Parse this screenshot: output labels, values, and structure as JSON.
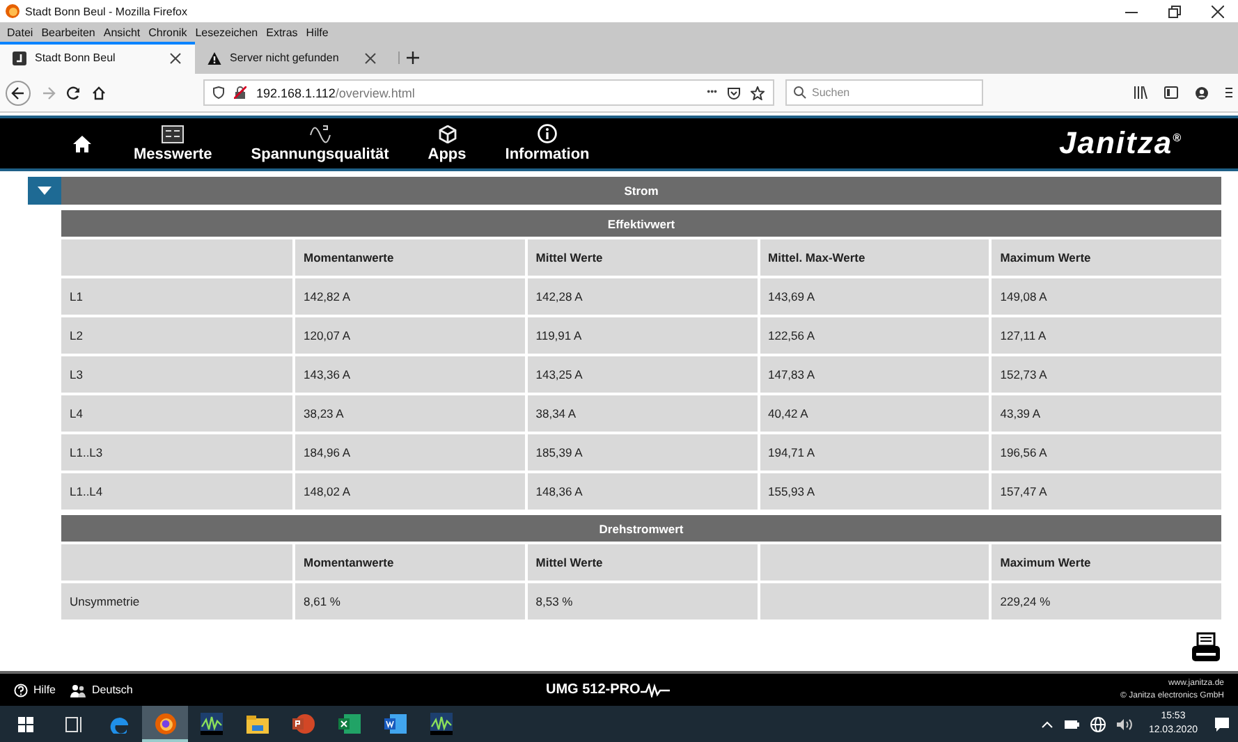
{
  "window": {
    "title": "Stadt Bonn Beul - Mozilla Firefox"
  },
  "menu": [
    "Datei",
    "Bearbeiten",
    "Ansicht",
    "Chronik",
    "Lesezeichen",
    "Extras",
    "Hilfe"
  ],
  "tabs": [
    {
      "label": "Stadt Bonn Beul",
      "kind": "page",
      "selected": true
    },
    {
      "label": "Server nicht gefunden",
      "kind": "warning",
      "selected": false
    }
  ],
  "address_bar": {
    "host": "192.168.1.112",
    "path": "/overview.html",
    "more": "•••"
  },
  "search": {
    "placeholder": "Suchen"
  },
  "app_nav": [
    {
      "label": "Messwerte",
      "kind": "meter"
    },
    {
      "label": "Spannungsqualität",
      "kind": "wave"
    },
    {
      "label": "Apps",
      "kind": "apps"
    },
    {
      "label": "Information",
      "kind": "info"
    }
  ],
  "logo": "Janitza$^{®}$",
  "section": {
    "title": "Strom",
    "expanded": true
  },
  "tables": [
    {
      "title": "Effektivwert",
      "columns": [
        {
          "text": "Momentanwerte"
        },
        {
          "text": "Mittel Werte"
        },
        {
          "text": "Mittel. Max-Werte"
        },
        {
          "text": "Maximum Werte"
        }
      ],
      "rows": [
        {
          "label": "L1",
          "values": [
            {
              "text": "142,82 A"
            },
            {
              "text": "142,28 A"
            },
            {
              "text": "143,69 A"
            },
            {
              "text": "149,08 A"
            }
          ]
        },
        {
          "label": "L2",
          "values": [
            {
              "text": "120,07 A"
            },
            {
              "text": "119,91 A"
            },
            {
              "text": "122,56 A"
            },
            {
              "text": "127,11 A"
            }
          ]
        },
        {
          "label": "L3",
          "values": [
            {
              "text": "143,36 A"
            },
            {
              "text": "143,25 A"
            },
            {
              "text": "147,83 A"
            },
            {
              "text": "152,73 A"
            }
          ]
        },
        {
          "label": "L4",
          "values": [
            {
              "text": "38,23 A"
            },
            {
              "text": "38,34 A"
            },
            {
              "text": "40,42 A"
            },
            {
              "text": "43,39 A"
            }
          ]
        },
        {
          "label": "L1..L3",
          "values": [
            {
              "text": "184,96 A"
            },
            {
              "text": "185,39 A"
            },
            {
              "text": "194,71 A"
            },
            {
              "text": "196,56 A"
            }
          ]
        },
        {
          "label": "L1..L4",
          "values": [
            {
              "text": "148,02 A"
            },
            {
              "text": "148,36 A"
            },
            {
              "text": "155,93 A"
            },
            {
              "text": "157,47 A"
            }
          ]
        }
      ]
    },
    {
      "title": "Drehstromwert",
      "columns": [
        {
          "text": "Momentanwerte"
        },
        {
          "text": "Mittel Werte"
        },
        {
          "kind": "empty"
        },
        {
          "text": "Maximum Werte"
        }
      ],
      "rows": [
        {
          "label": "Unsymmetrie",
          "values": [
            {
              "text": "8,61 %"
            },
            {
              "text": "8,53 %"
            },
            {
              "kind": "empty"
            },
            {
              "text": "229,24 %"
            }
          ]
        }
      ]
    }
  ],
  "footer": {
    "help": "Hilfe",
    "language": "Deutsch",
    "device": "UMG 512-PRO",
    "website": "www.janitza.de",
    "copyright": "© Janitza electronics GmbH"
  },
  "taskbar": {
    "apps": [
      {
        "kind": "taskview",
        "selected": false
      },
      {
        "kind": "edge",
        "selected": false
      },
      {
        "kind": "firefox",
        "selected": true
      },
      {
        "kind": "janitza",
        "selected": false
      },
      {
        "kind": "explorer",
        "selected": false
      },
      {
        "kind": "powerpoint",
        "selected": false
      },
      {
        "kind": "excel",
        "selected": false
      },
      {
        "kind": "word",
        "selected": false
      },
      {
        "kind": "janitza",
        "selected": false
      }
    ],
    "time": "15:53",
    "date": "12.03.2020"
  }
}
